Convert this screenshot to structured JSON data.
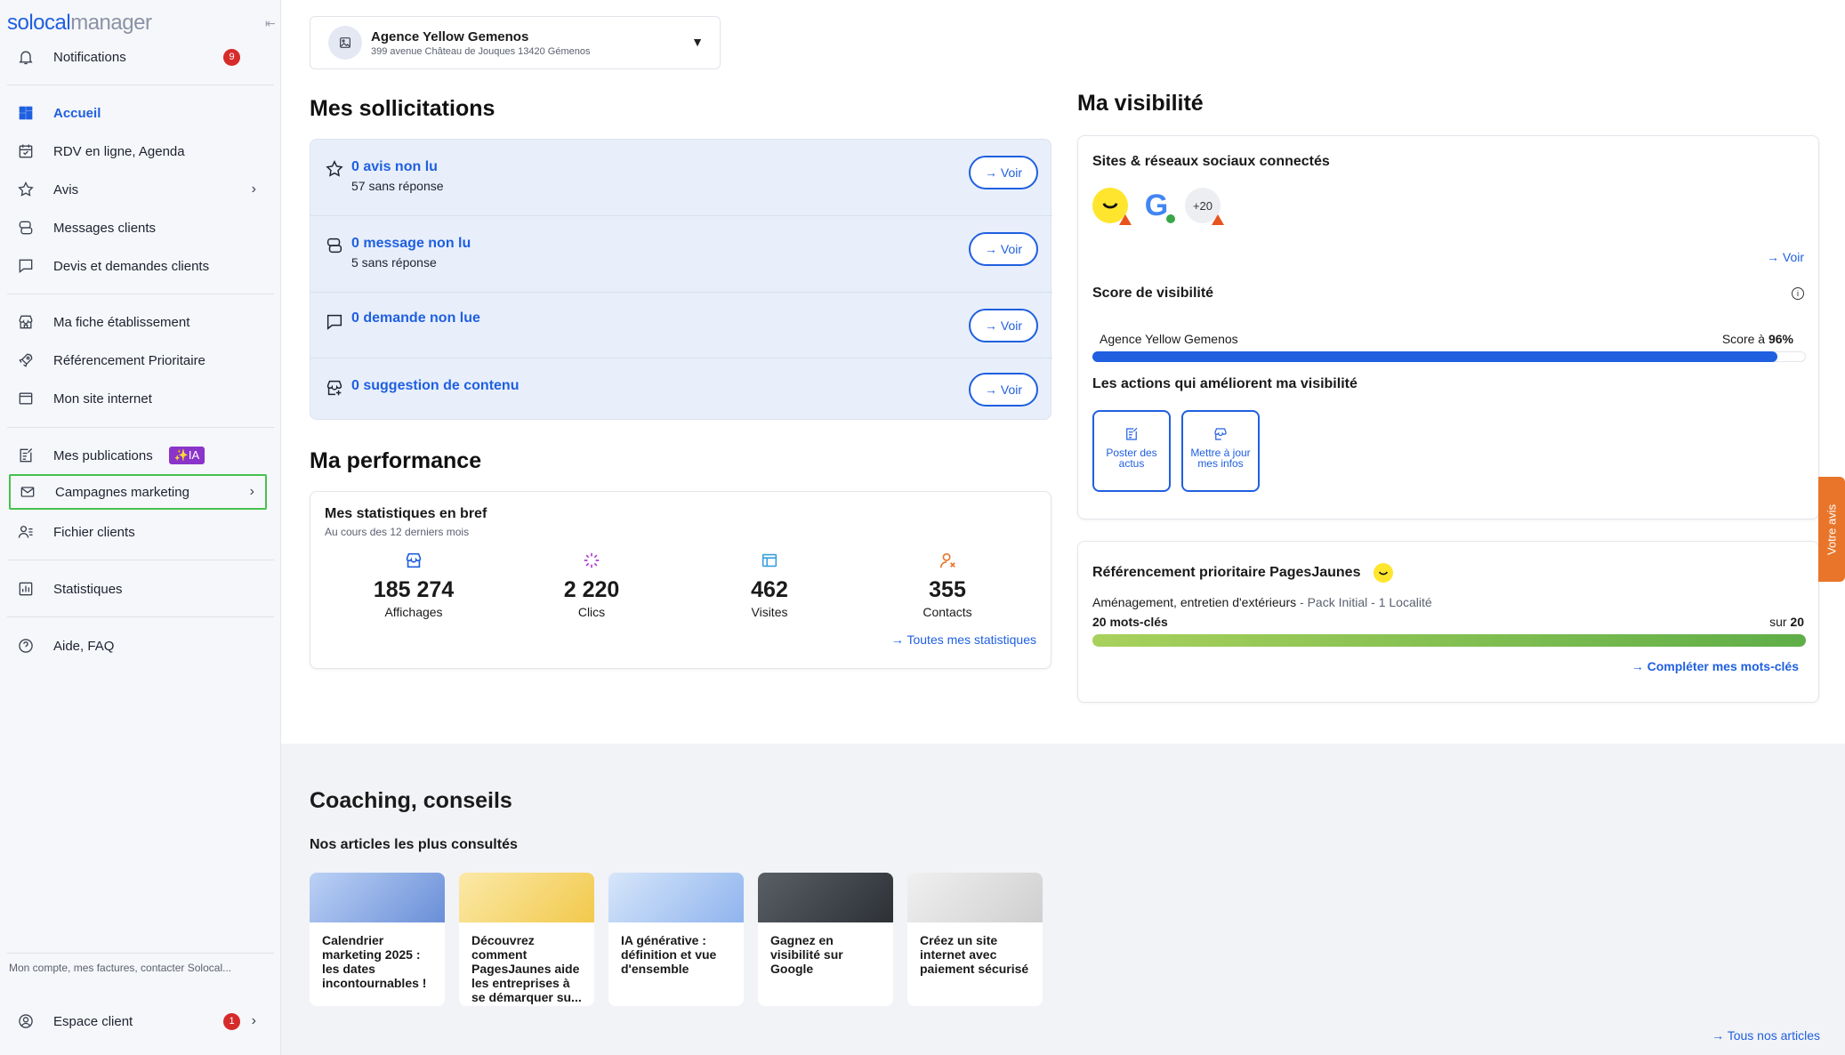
{
  "brand": {
    "part1": "solocal",
    "part2": "manager"
  },
  "sidebar": {
    "notifications": {
      "label": "Notifications",
      "badge": "9"
    },
    "items": [
      {
        "label": "Accueil"
      },
      {
        "label": "RDV en ligne, Agenda"
      },
      {
        "label": "Avis"
      },
      {
        "label": "Messages clients"
      },
      {
        "label": "Devis et demandes clients"
      },
      {
        "label": "Ma fiche établissement"
      },
      {
        "label": "Référencement Prioritaire"
      },
      {
        "label": "Mon site internet"
      },
      {
        "label": "Mes publications",
        "badge": "✨IA"
      },
      {
        "label": "Campagnes marketing"
      },
      {
        "label": "Fichier clients"
      },
      {
        "label": "Statistiques"
      },
      {
        "label": "Aide, FAQ"
      }
    ],
    "account_text": "Mon compte, mes factures, contacter Solocal...",
    "espace_client": {
      "label": "Espace client",
      "badge": "1"
    }
  },
  "selector": {
    "name": "Agence Yellow Gemenos",
    "address": "399 avenue Château de Jouques 13420 Gémenos"
  },
  "solicitations": {
    "title": "Mes sollicitations",
    "voir": "Voir",
    "rows": [
      {
        "title": "0 avis non lu",
        "sub": "57 sans réponse"
      },
      {
        "title": "0 message non lu",
        "sub": "5 sans réponse"
      },
      {
        "title": "0 demande non lue",
        "sub": ""
      },
      {
        "title": "0 suggestion de contenu",
        "sub": ""
      }
    ]
  },
  "performance": {
    "title": "Ma performance",
    "card_title": "Mes statistiques en bref",
    "card_sub": "Au cours des 12 derniers mois",
    "stats": [
      {
        "value": "185 274",
        "label": "Affichages"
      },
      {
        "value": "2 220",
        "label": "Clics"
      },
      {
        "value": "462",
        "label": "Visites"
      },
      {
        "value": "355",
        "label": "Contacts"
      }
    ],
    "link": "Toutes mes statistiques"
  },
  "visibility": {
    "title": "Ma visibilité",
    "sites_title": "Sites & réseaux sociaux connectés",
    "more_count": "+20",
    "voir": "Voir",
    "score_title": "Score de visibilité",
    "score_name": "Agence Yellow Gemenos",
    "score_prefix": "Score à ",
    "score_value": "96%",
    "score_fraction": 0.96,
    "actions_title": "Les actions qui améliorent ma visibilité",
    "actions": [
      {
        "label": "Poster des actus"
      },
      {
        "label": "Mettre à jour mes infos"
      }
    ]
  },
  "referencement": {
    "title": "Référencement prioritaire PagesJaunes",
    "category": "Aménagement, entretien d'extérieurs",
    "pack": " - Pack Initial - 1 Localité",
    "keywords": "20 mots-clés",
    "sur_prefix": "sur ",
    "sur_value": "20",
    "link": "Compléter mes mots-clés"
  },
  "coaching": {
    "title": "Coaching, conseils",
    "subtitle": "Nos articles les plus consultés",
    "articles": [
      {
        "title": "Calendrier marketing 2025 : les dates incontournables !"
      },
      {
        "title": "Découvrez comment PagesJaunes aide les entreprises à se démarquer su..."
      },
      {
        "title": "IA générative : définition et vue d'ensemble"
      },
      {
        "title": "Gagnez en visibilité sur Google"
      },
      {
        "title": "Créez un site internet avec paiement sécurisé"
      }
    ],
    "all_link": "Tous nos articles"
  },
  "feedback": "Votre avis",
  "colors": {
    "accent": "#1f5fe0",
    "green": "#47c04d",
    "badge_red": "#d62b2b",
    "ia_purple": "#8a34c9"
  }
}
